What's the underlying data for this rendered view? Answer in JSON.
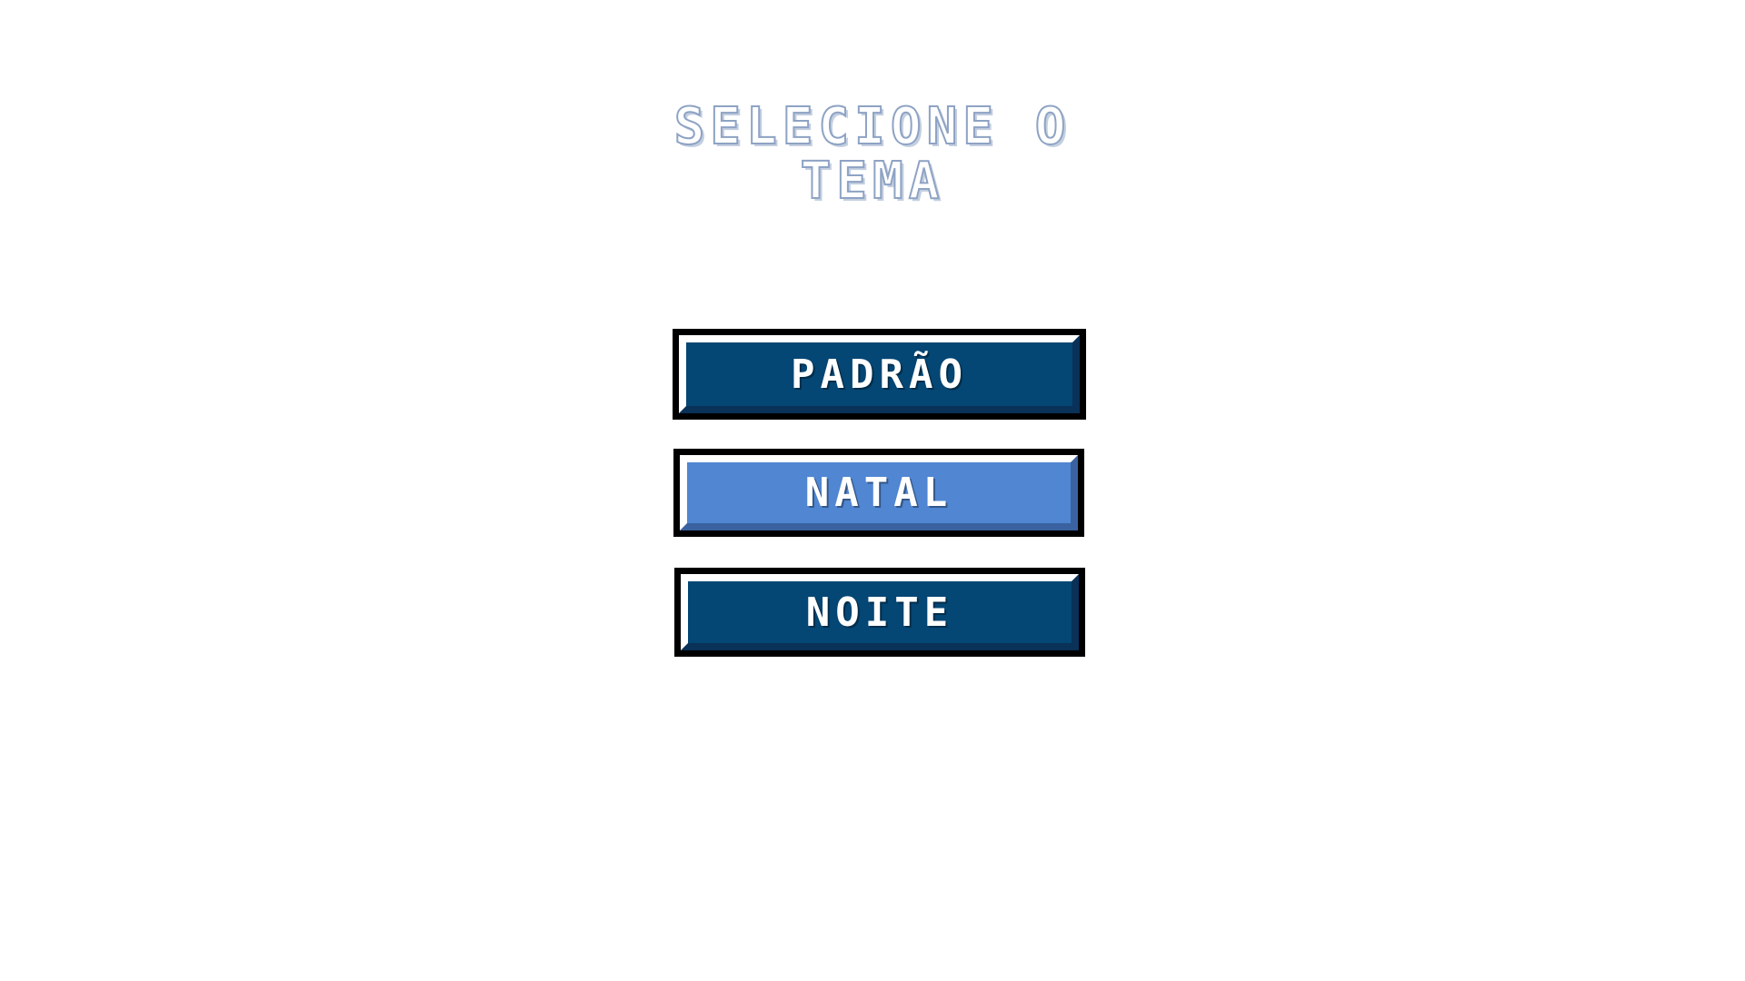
{
  "title": {
    "line1": "SELECIONE O",
    "line2": "TEMA"
  },
  "themes": [
    {
      "label": "PADRÃO",
      "selected": false
    },
    {
      "label": "NATAL",
      "selected": true
    },
    {
      "label": "NOITE",
      "selected": false
    }
  ],
  "colors": {
    "background": "#ffffff",
    "button_fill": "#044674",
    "button_selected_fill": "#5086d2",
    "button_border": "#000000",
    "button_highlight": "#ffffff",
    "title_outline": "#8ea3c4"
  }
}
